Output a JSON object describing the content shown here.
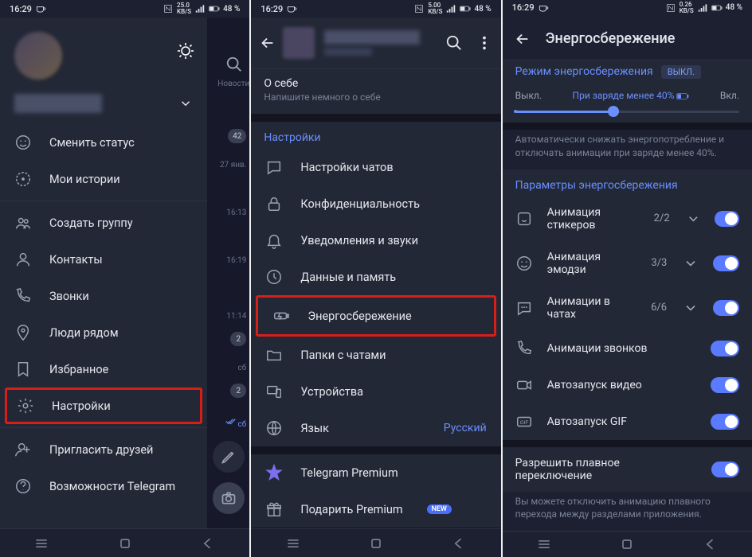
{
  "status": {
    "time": "16:29",
    "net_speed1": "25.0",
    "net_speed2": "5.00",
    "net_speed3": "0.26",
    "net_unit": "KB/S",
    "battery_pct": "48 %"
  },
  "panel1": {
    "tab_news": "Новости",
    "items": [
      {
        "label": "Сменить статус",
        "icon": "smile"
      },
      {
        "label": "Мои истории",
        "icon": "play-circle"
      },
      {
        "label": "Создать группу",
        "icon": "users"
      },
      {
        "label": "Контакты",
        "icon": "user"
      },
      {
        "label": "Звонки",
        "icon": "phone"
      },
      {
        "label": "Люди рядом",
        "icon": "location"
      },
      {
        "label": "Избранное",
        "icon": "bookmark"
      },
      {
        "label": "Настройки",
        "icon": "settings",
        "highlight": true
      },
      {
        "label": "Пригласить друзей",
        "icon": "invite"
      },
      {
        "label": "Возможности Telegram",
        "icon": "help"
      }
    ],
    "sliver_labels": {
      "badge42": "42",
      "date1": "27 янв.",
      "time1": "16:13",
      "time2": "16:19",
      "time3": "11:14",
      "badge2": "2",
      "sat": "сб"
    }
  },
  "panel2": {
    "about_title": "О себе",
    "about_sub": "Напишите немного о себе",
    "section_title": "Настройки",
    "items": [
      {
        "label": "Настройки чатов",
        "icon": "chat"
      },
      {
        "label": "Конфиденциальность",
        "icon": "lock"
      },
      {
        "label": "Уведомления и звуки",
        "icon": "bell"
      },
      {
        "label": "Данные и память",
        "icon": "data"
      },
      {
        "label": "Энергосбережение",
        "icon": "battery",
        "highlight": true
      },
      {
        "label": "Папки с чатами",
        "icon": "folder"
      },
      {
        "label": "Устройства",
        "icon": "devices"
      },
      {
        "label": "Язык",
        "icon": "globe",
        "tail": "Русский"
      }
    ],
    "premium": [
      {
        "label": "Telegram Premium",
        "icon": "star"
      },
      {
        "label": "Подарить Premium",
        "icon": "gift",
        "new": "NEW"
      }
    ]
  },
  "panel3": {
    "title": "Энергосбережение",
    "mode_label": "Режим энергосбережения",
    "mode_badge": "ВЫКЛ.",
    "slider_off": "Выкл.",
    "slider_mid": "При заряде менее 40%",
    "slider_on": "Вкл.",
    "hint1": "Автоматически снижать энергопотребление и отключать анимации при заряде менее 40%.",
    "section_title": "Параметры энергосбережения",
    "params": [
      {
        "label": "Анимация стикеров",
        "count": "2/2",
        "icon": "sticker",
        "chev": true
      },
      {
        "label": "Анимация эмодзи",
        "count": "3/3",
        "icon": "smile",
        "chev": true
      },
      {
        "label": "Анимации в чатах",
        "count": "6/6",
        "icon": "dots",
        "chev": true
      },
      {
        "label": "Анимации звонков",
        "icon": "phone2"
      },
      {
        "label": "Автозапуск видео",
        "icon": "video"
      },
      {
        "label": "Автозапуск GIF",
        "icon": "gif"
      }
    ],
    "smooth": {
      "label": "Разрешить плавное переключение"
    },
    "hint2": "Вы можете отключить анимацию плавного перехода между разделами приложения."
  }
}
